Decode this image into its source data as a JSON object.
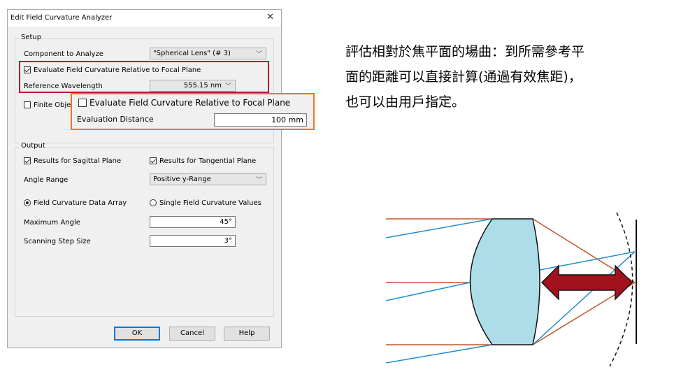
{
  "dialog": {
    "title": "Edit Field Curvature Analyzer",
    "close_glyph": "✕",
    "setup": {
      "group_label": "Setup",
      "component_label": "Component to Analyze",
      "component_value": "\"Spherical Lens\" (# 3)",
      "evaluate_label": "Evaluate Field Curvature Relative to Focal Plane",
      "evaluate_checked": true,
      "wavelength_label": "Reference Wavelength",
      "wavelength_value": "555.15 nm",
      "finite_label": "Finite Obje",
      "finite_checked": false
    },
    "popup": {
      "evaluate_label": "Evaluate Field Curvature Relative to Focal Plane",
      "evaluate_checked": false,
      "distance_label": "Evaluation Distance",
      "distance_value": "100 mm"
    },
    "output": {
      "group_label": "Output",
      "sagittal_label": "Results for Sagittal Plane",
      "sagittal_checked": true,
      "tangential_label": "Results for Tangential Plane",
      "tangential_checked": true,
      "angle_range_label": "Angle Range",
      "angle_range_value": "Positive y-Range",
      "data_array_label": "Field Curvature Data Array",
      "data_array_selected": true,
      "single_values_label": "Single Field Curvature Values",
      "single_values_selected": false,
      "max_angle_label": "Maximum Angle",
      "max_angle_value": "45°",
      "step_label": "Scanning Step Size",
      "step_value": "3°"
    },
    "buttons": {
      "ok": "OK",
      "cancel": "Cancel",
      "help": "Help"
    }
  },
  "note": {
    "line1": "評估相對於焦平面的場曲：到所需參考平",
    "line2": "面的距離可以直接計算(通過有效焦距)，",
    "line3": "也可以由用戶指定。"
  },
  "colors": {
    "highlight_red": "#b51830",
    "highlight_orange": "#ee7422",
    "lens_fill": "#acdde9",
    "ray_blue": "#1f8fcc",
    "ray_orange": "#c0562a",
    "arrow_red": "#a3111e"
  },
  "icons": {
    "dropdown": "chevron-down-icon",
    "checkbox": "checkmark-icon",
    "radio": "radio-dot-icon"
  }
}
